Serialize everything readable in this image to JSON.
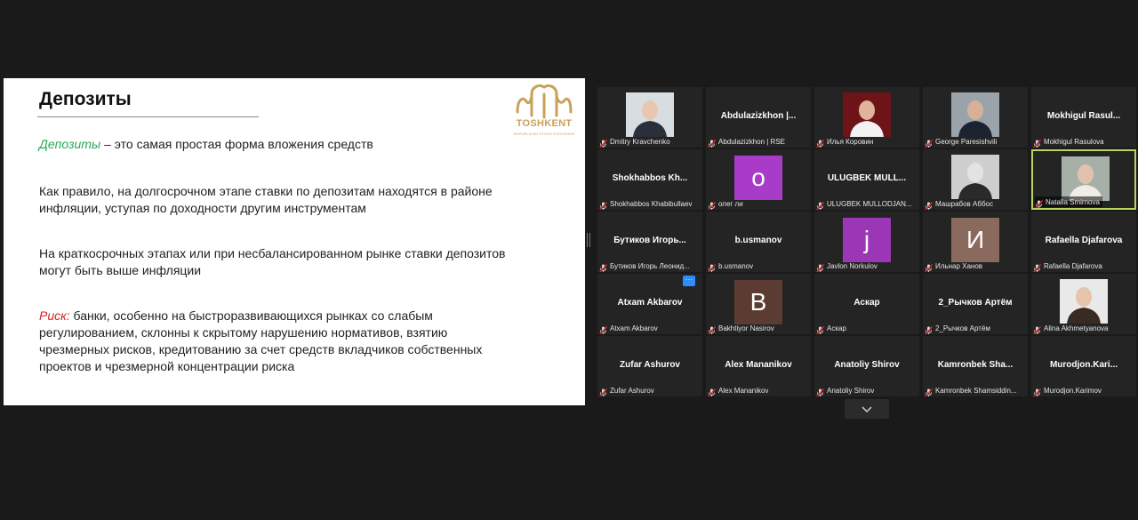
{
  "slide": {
    "title": "Депозиты",
    "logo_text": "TOSHKENT",
    "logo_subtext": "REPUBLICAN STOCK EXCHANGE",
    "p1_highlight": "Депозиты",
    "p1_text": " – это самая простая форма вложения средств",
    "p2_text": "Как правило, на долгосрочном этапе ставки по депозитам находятся в районе инфляции, уступая по доходности другим инструментам",
    "p3_text": "На краткосрочных этапах или при несбалансированном рынке ставки депозитов могут быть выше инфляции",
    "p4_highlight": "Риск:",
    "p4_text": " банки, особенно на быстроразвивающихся рынках со слабым регулированием, склонны к скрытому нарушению нормативов, взятию чрезмерных рисков, кредитованию за счет средств вкладчиков собственных проектов и чрезмерной концентрации риска",
    "colors": {
      "highlight_green": "#29a85a",
      "highlight_red": "#d92020",
      "logo_gold": "#c9a15a"
    }
  },
  "participants": [
    {
      "name": "Dmitry Kravchenko",
      "display": "photo",
      "active": false
    },
    {
      "name": "Abdulazizkhon | RSE",
      "display": "name",
      "tile_label": "Abdulazizkhon  |...",
      "active": false
    },
    {
      "name": "Илья Коровин",
      "display": "photo",
      "active": false
    },
    {
      "name": "George Paresishvili",
      "display": "photo",
      "active": false
    },
    {
      "name": "Mokhigul Rasulova",
      "display": "name",
      "tile_label": "Mokhigul  Rasul...",
      "active": false
    },
    {
      "name": "Shokhabbos Khabibullaev",
      "display": "name",
      "tile_label": "Shokhabbos  Kh...",
      "active": false
    },
    {
      "name": "олег ли",
      "display": "avatar",
      "initial": "o",
      "avatar_color": "#a83cc8",
      "active": false
    },
    {
      "name": "ULUGBEK MULLODJAN...",
      "display": "name",
      "tile_label": "ULUGBEK  MULL...",
      "active": false
    },
    {
      "name": "Машрабов Аббос",
      "display": "photo",
      "active": false
    },
    {
      "name": "Natalia Smirnova",
      "display": "photo",
      "active": true
    },
    {
      "name": "Бутиков Игорь Леонид...",
      "display": "name",
      "tile_label": "Бутиков  Игорь...",
      "active": false
    },
    {
      "name": "b.usmanov",
      "display": "name",
      "tile_label": "b.usmanov",
      "active": false
    },
    {
      "name": "Javlon Norkulov",
      "display": "avatar",
      "initial": "j",
      "avatar_color": "#9b36b7",
      "active": false
    },
    {
      "name": "Ильнар Ханов",
      "display": "avatar",
      "initial": "И",
      "avatar_color": "#8b6a5e",
      "active": false
    },
    {
      "name": "Rafaella Djafarova",
      "display": "name",
      "tile_label": "Rafaella  Djafarova",
      "active": false
    },
    {
      "name": "Atxam Akbarov",
      "display": "name",
      "tile_label": "Atxam  Akbarov",
      "active": false,
      "badge": "···"
    },
    {
      "name": "Bakhtiyor Nasirov",
      "display": "avatar",
      "initial": "B",
      "avatar_color": "#5b3b32",
      "active": false
    },
    {
      "name": "Аскар",
      "display": "name",
      "tile_label": "Аскар",
      "active": false
    },
    {
      "name": "2_Рычков Артём",
      "display": "name",
      "tile_label": "2_Рычков  Артём",
      "active": false
    },
    {
      "name": "Alina Akhmetyanova",
      "display": "photo",
      "active": false
    },
    {
      "name": "Zufar Ashurov",
      "display": "name",
      "tile_label": "Zufar  Ashurov",
      "active": false
    },
    {
      "name": "Alex Mananikov",
      "display": "name",
      "tile_label": "Alex  Mananikov",
      "active": false
    },
    {
      "name": "Anatoliy Shirov",
      "display": "name",
      "tile_label": "Anatoliy  Shirov",
      "active": false
    },
    {
      "name": "Kamronbek Shamsiddin...",
      "display": "name",
      "tile_label": "Kamronbek  Sha...",
      "active": false
    },
    {
      "name": "Murodjon.Karimov",
      "display": "name",
      "tile_label": "Murodjon.Kari...",
      "active": false
    }
  ],
  "icons": {
    "mic": "mic-muted-icon",
    "next_page": "chevron-down-icon",
    "more": "more-options-icon"
  }
}
